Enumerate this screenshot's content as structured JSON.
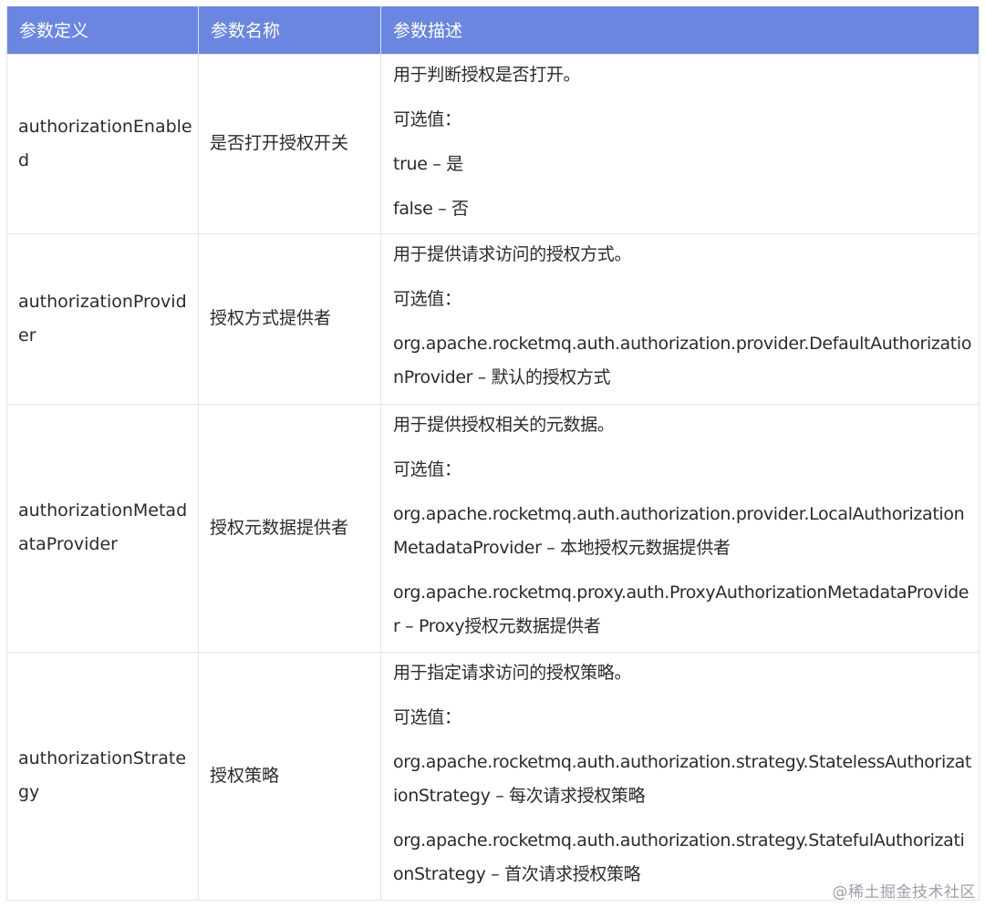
{
  "table": {
    "headers": [
      "参数定义",
      "参数名称",
      "参数描述"
    ],
    "rows": [
      {
        "definition": "authorizationEnabled",
        "name": "是否打开授权开关",
        "description": [
          "用于判断授权是否打开。",
          "可选值：",
          "true – 是",
          "false – 否"
        ]
      },
      {
        "definition": "authorizationProvider",
        "name": "授权方式提供者",
        "description": [
          "用于提供请求访问的授权方式。",
          "可选值：",
          "org.apache.rocketmq.auth.authorization.provider.DefaultAuthorizationProvider – 默认的授权方式"
        ]
      },
      {
        "definition": "authorizationMetadataProvider",
        "name": "授权元数据提供者",
        "description": [
          "用于提供授权相关的元数据。",
          "可选值：",
          "org.apache.rocketmq.auth.authorization.provider.LocalAuthorizationMetadataProvider – 本地授权元数据提供者",
          "org.apache.rocketmq.proxy.auth.ProxyAuthorizationMetadataProvider – Proxy授权元数据提供者"
        ]
      },
      {
        "definition": "authorizationStrategy",
        "name": "授权策略",
        "description": [
          "用于指定请求访问的授权策略。",
          "可选值：",
          "org.apache.rocketmq.auth.authorization.strategy.StatelessAuthorizationStrategy – 每次请求授权策略",
          "org.apache.rocketmq.auth.authorization.strategy.StatefulAuthorizationStrategy – 首次请求授权策略"
        ]
      }
    ]
  },
  "watermark": "@稀土掘金技术社区",
  "colors": {
    "header_bg": "#6a86e0",
    "header_text": "#ffffff",
    "border": "#e3e5ea",
    "body_text": "#2b2b2b",
    "watermark": "#9aa0aa"
  }
}
